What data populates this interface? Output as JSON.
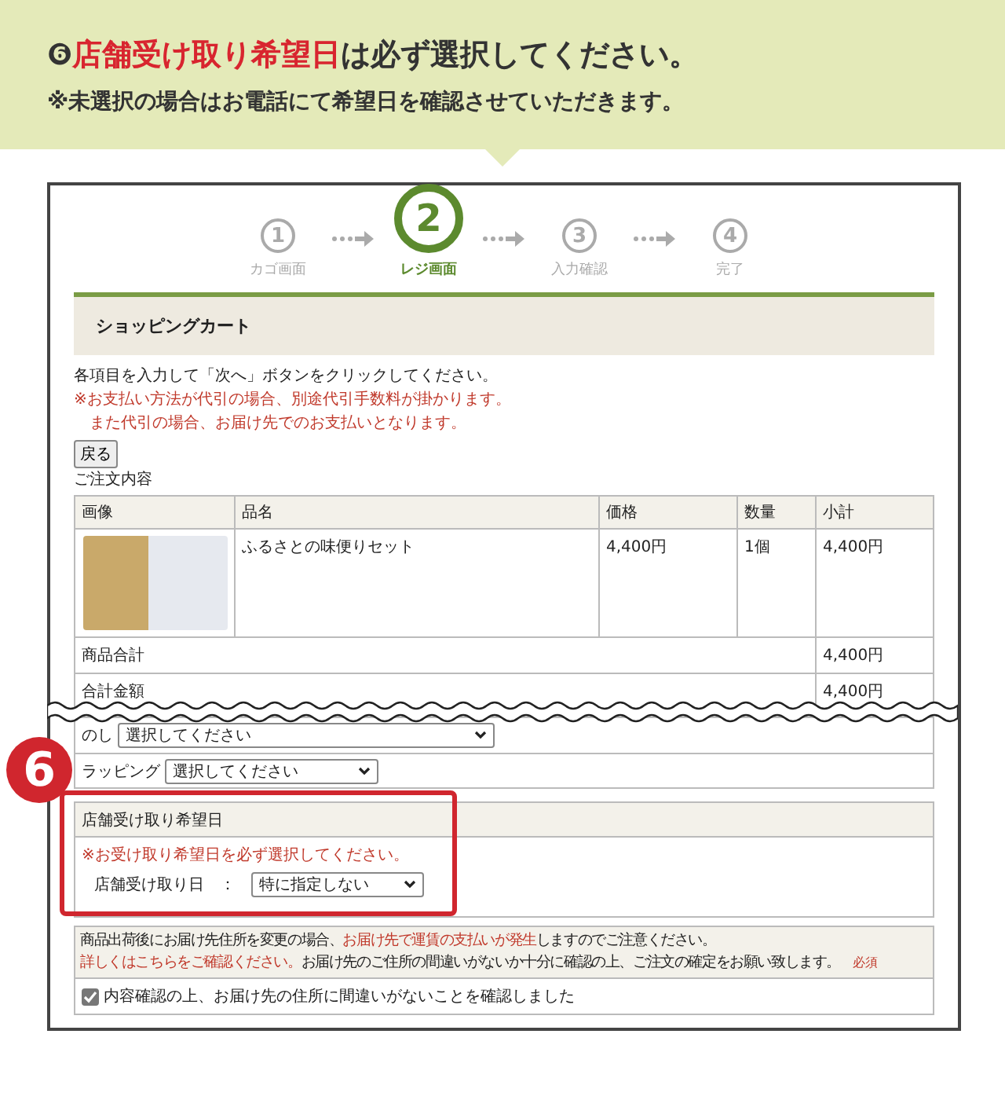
{
  "banner": {
    "number": "❻",
    "highlight": "店舗受け取り希望日",
    "title_rest": "は必ず選択してください。",
    "note": "※未選択の場合はお電話にて希望日を確認させていただきます。"
  },
  "steps": [
    {
      "number": "1",
      "label": "カゴ画面",
      "selected": false
    },
    {
      "number": "2",
      "label": "レジ画面",
      "selected": true
    },
    {
      "number": "3",
      "label": "入力確認",
      "selected": false
    },
    {
      "number": "4",
      "label": "完了",
      "selected": false
    }
  ],
  "cart": {
    "title": "ショッピングカート",
    "instruction": "各項目を入力して「次へ」ボタンをクリックしてください。",
    "notes": [
      "※お支払い方法が代引の場合、別途代引手数料が掛かります。",
      "また代引の場合、お届け先でのお支払いとなります。"
    ],
    "back_button": "戻る",
    "order_heading": "ご注文内容",
    "table": {
      "columns": [
        "画像",
        "品名",
        "価格",
        "数量",
        "小計"
      ],
      "rows": [
        {
          "name": "ふるさとの味便りセット",
          "price": "4,400円",
          "quantity": "1個",
          "subtotal": "4,400円"
        }
      ],
      "totals": [
        {
          "label": "商品合計",
          "value": "4,400円"
        },
        {
          "label": "合計金額",
          "value": "4,400円"
        }
      ]
    }
  },
  "options": [
    {
      "label": "のし",
      "value": "選択してください"
    },
    {
      "label": "ラッピング",
      "value": "選択してください"
    }
  ],
  "store_pickup": {
    "badge": "6",
    "title": "店舗受け取り希望日",
    "warning": "※お受け取り希望日を必ず選択してください。",
    "field_label": "店舗受け取り日",
    "separator": "：",
    "value": "特に指定しない"
  },
  "notice": {
    "segments": [
      {
        "kind": "plain",
        "text": "商品出荷後にお届け先住所を変更の場合、"
      },
      {
        "kind": "alert",
        "text": "お届け先で運賃の支払いが発生"
      },
      {
        "kind": "plain",
        "text": "しますのでご注意ください。"
      },
      {
        "kind": "link",
        "text": "詳しくはこちらをご確認ください。"
      },
      {
        "kind": "plain",
        "text": "お届け先のご住所の間違いがないか十分に確認の上、ご注文の確定をお願い致します。"
      }
    ],
    "required": "必須"
  },
  "confirm": {
    "checked": true,
    "label": "内容確認の上、お届け先の住所に間違いがないことを確認しました"
  }
}
